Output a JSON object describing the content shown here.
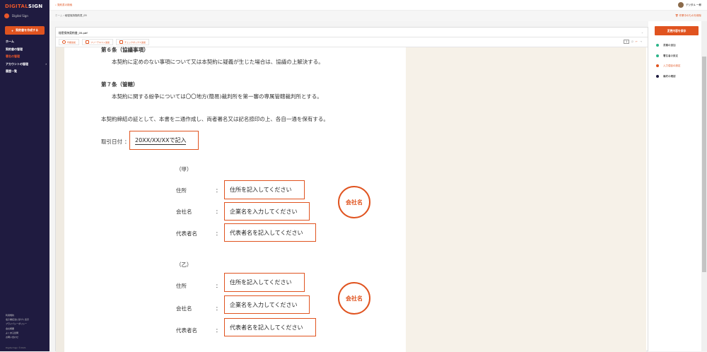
{
  "sidebar": {
    "logo_a": "DIGITAL",
    "logo_b": "SIGN",
    "account": "Digital Sign",
    "create_label": "契約書を作成する",
    "items": [
      {
        "label": "ホーム"
      },
      {
        "label": "契約書の管理"
      },
      {
        "label": "署名の管理"
      },
      {
        "label": "アカウントの管理"
      },
      {
        "label": "履歴一覧"
      }
    ],
    "footer": [
      "利用規約",
      "電子署名法に基づく表示",
      "プライバシーポリシー",
      "会社概要",
      "よくある質問",
      "お問い合わせ"
    ],
    "copyright": "Digital Sign ©2021"
  },
  "topbar": {
    "search": "契約書の検索",
    "user": "デジタル 一郎"
  },
  "breadcrumb": {
    "home": "ホーム",
    "current": "秘密保持契約書_05",
    "delete": "作業中のものを削除"
  },
  "file": {
    "name": "秘密保持契約書_05.pdf",
    "page": "1",
    "page_total": "/2"
  },
  "tools": [
    "印鑑追加",
    "フリーテキスト追加",
    "チェックボックス追加"
  ],
  "doc": {
    "art6_title": "第６条（協議事項）",
    "art6_body": "本契約に定めのない事項について又は本契約に疑義が生じた場合は、協議の上解決する。",
    "art7_title": "第７条（管轄）",
    "art7_body": "本契約に関する紛争については〇〇地方(簡易)裁判所を第一審の専属管轄裁判所とする。",
    "closing": "本契約締結の証として、本書を二通作成し、両者署名又は記名捺印の上、各自一通を保有する。",
    "date_label": "取引日付",
    "date_value": "20XX/XX/XXで記入",
    "colon": "：",
    "parties": [
      {
        "title": "（甲）",
        "address_label": "住所",
        "address": "住所を記入してください",
        "company_label": "会社名",
        "company": "企業名を入力してください",
        "rep_label": "代表者名",
        "rep": "代表者名を記入してください",
        "stamp": "会社名"
      },
      {
        "title": "（乙）",
        "address_label": "住所",
        "address": "住所を記入してください",
        "company_label": "会社名",
        "company": "企業名を入力してください",
        "rep_label": "代表者名",
        "rep": "代表者名を記入してください",
        "stamp": "会社名"
      }
    ]
  },
  "right": {
    "save_label": "変更内容を保存",
    "steps": [
      {
        "label": "書類の追加",
        "color": "#2bb58a"
      },
      {
        "label": "署名者の設定",
        "color": "#2bb58a"
      },
      {
        "label": "入力項目の設定",
        "color": "#e0531f"
      },
      {
        "label": "最終の確認",
        "color": "#1f1b40"
      }
    ]
  }
}
